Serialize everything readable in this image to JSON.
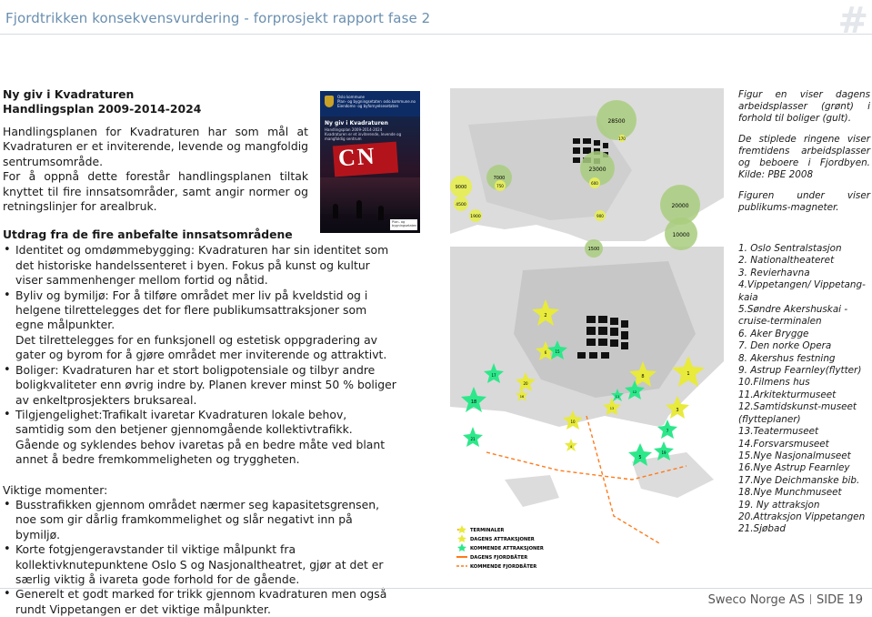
{
  "header": {
    "title": "Fjordtrikken konsekvensvurdering - forprosjekt rapport fase 2",
    "logo": "#"
  },
  "intro": {
    "heading_line1": "Ny giv i Kvadraturen",
    "heading_line2": "Handlingsplan 2009-2014-2024",
    "paragraph1": "Handlingsplanen for Kvadraturen har som mål at Kvadraturen er et inviterende, levende og mangfoldig sentrumsområde.",
    "paragraph2": "For å oppnå dette forestår handlingsplanen tiltak knyttet til fire innsatsområder, samt angir normer og retningslinjer for arealbruk."
  },
  "cover_image": {
    "org_line1": "Oslo kommune",
    "org_line2": "Plan- og bygningsetaten",
    "org_line3": "Eiendoms- og byfornyelsesetaten",
    "web": "oslo.kommune.no",
    "title": "Ny giv i Kvadraturen",
    "subtitle_line1": "Handlingsplan 2009-2014-2024",
    "subtitle_line2": "Kvadraturen er et inviterende, levende og mangfoldig sentrum",
    "sign": "CN",
    "footer_line1": "Plan- og",
    "footer_line2": "bygningsetaten"
  },
  "utdrag": {
    "heading": "Utdrag  fra de fire anbefalte innsatsområdene",
    "items": [
      {
        "text": "Identitet og omdømmebygging: Kvadraturen har sin identitet som det historiske handelssenteret i byen. Fokus på kunst og kultur viser sammenhenger mellom fortid og nåtid.",
        "extra": ""
      },
      {
        "text": "Byliv og bymiljø: For å tilføre området mer liv på  kveldstid og i   helgene tilrettelegges det for flere publikumsattraksjoner som egne målpunkter.",
        "extra": "Det tilrettelegges for en funksjonell og estetisk oppgradering av gater og byrom for å gjøre området mer inviterende og attraktivt."
      },
      {
        "text": "Boliger: Kvadraturen har et stort boligpotensiale og tilbyr andre boligkvaliteter enn øvrig indre by. Planen krever minst 50 % boliger av enkeltprosjekters bruksareal.",
        "extra": ""
      },
      {
        "text": "Tilgjengelighet:Trafikalt ivaretar Kvadraturen lokale behov, samtidig som  den betjener gjennomgående kollektivtrafikk.",
        "extra": "Gående og syklendes behov ivaretas på en bedre måte ved blant annet å bedre fremkommeligheten og tryggheten."
      }
    ]
  },
  "viktige": {
    "heading": "Viktige momenter:",
    "items": [
      "Busstrafikken  gjennom  området nærmer seg kapasitetsgrensen, noe som gir dårlig framkommelighet og slår negativt inn på bymiljø.",
      "Korte fotgjengeravstander til viktige målpunkt fra kollektivknutepunktene Oslo S og Nasjonaltheatret, gjør at det er særlig viktig å ivareta gode forhold for de gående.",
      "Generelt et godt marked for trikk gjennom kvadraturen men også rundt Vippetangen er det viktige målpunkter."
    ]
  },
  "map": {
    "bubbles": [
      {
        "label": "28500",
        "color": "#a9cc7e"
      },
      {
        "label": "170",
        "color": "#e5ec5e"
      },
      {
        "label": "23000",
        "color": "#a9cc7e"
      },
      {
        "label": "9000",
        "color": "#e5ec5e"
      },
      {
        "label": "7000",
        "color": "#a9cc7e"
      },
      {
        "label": "750",
        "color": "#e5ec5e"
      },
      {
        "label": "600",
        "color": "#e5ec5e"
      },
      {
        "label": "4500",
        "color": "#e5ec5e"
      },
      {
        "label": "1900",
        "color": "#e5ec5e"
      },
      {
        "label": "900",
        "color": "#e5ec5e"
      },
      {
        "label": "20000",
        "color": "#a9cc7e"
      },
      {
        "label": "10000",
        "color": "#a9cc7e"
      },
      {
        "label": "1500",
        "color": "#a9cc7e"
      }
    ],
    "stars": [
      {
        "label": "2",
        "color": "#e8ea3c"
      },
      {
        "label": "20",
        "color": "#e8ea3c"
      },
      {
        "label": "8",
        "color": "#e8ea3c"
      },
      {
        "label": "6",
        "color": "#e8ea3c"
      },
      {
        "label": "10",
        "color": "#e8ea3c"
      },
      {
        "label": "1",
        "color": "#e8ea3c"
      },
      {
        "label": "3",
        "color": "#e8ea3c"
      },
      {
        "label": "4",
        "color": "#e8ea3c"
      },
      {
        "label": "16",
        "color": "#e8ea3c"
      },
      {
        "label": "13",
        "color": "#e8ea3c"
      },
      {
        "label": "17",
        "color": "#2ce88a"
      },
      {
        "label": "18",
        "color": "#2ce88a"
      },
      {
        "label": "21",
        "color": "#2ce88a"
      },
      {
        "label": "5",
        "color": "#2ce88a"
      },
      {
        "label": "12",
        "color": "#2ce88a"
      },
      {
        "label": "19",
        "color": "#2ce88a"
      },
      {
        "label": "7",
        "color": "#2ce88a"
      },
      {
        "label": "15",
        "color": "#2ce88a"
      },
      {
        "label": "11",
        "color": "#2ce88a"
      }
    ],
    "legend": [
      {
        "label": "TERMINALER",
        "color": "#e8ea3c"
      },
      {
        "label": "DAGENS ATTRAKSJONER",
        "color": "#e8ea3c"
      },
      {
        "label": "KOMMENDE ATTRAKSJONER",
        "color": "#2ce88a"
      },
      {
        "label": "DAGENS FJORDBÅTER",
        "color": "#ff7a1a"
      },
      {
        "label": "KOMMENDE FJORDBÅTER",
        "color": "#ff7a1a"
      }
    ]
  },
  "caption": {
    "p1": "Figur en viser dagens arbeidsplasser (grønt) i forhold til boliger (gult).",
    "p2": "De stiplede ringene viser fremtidens arbeidsplasser og beboere i Fjordbyen. Kilde: PBE 2008",
    "p3": "Figuren under viser publikums-magneter.",
    "list": [
      "1. Oslo Sentralstasjon",
      "2. Nationaltheateret",
      "3. Revierhavna",
      "4.Vippetangen/ Vippetang-kaia",
      "5.Søndre Akershuskai - cruise-terminalen",
      "6. Aker Brygge",
      "7. Den norke Opera",
      "8. Akershus festning",
      "9. Astrup Fearnley(flytter)",
      "10.Filmens hus",
      "11.Arkitekturmuseet",
      "12.Samtidskunst-museet (flytteplaner)",
      "13.Teatermuseet",
      "14.Forsvarsmuseet",
      "15.Nye Nasjonalmuseet",
      "16.Nye Astrup Fearnley",
      "17.Nye Deichmanske bib.",
      "18.Nye Munchmuseet",
      "19. Ny attraksjon",
      "20.Attraksjon Vippetangen",
      "21.Sjøbad"
    ]
  },
  "footer": {
    "company": "Sweco Norge AS",
    "page": "SIDE 19"
  }
}
